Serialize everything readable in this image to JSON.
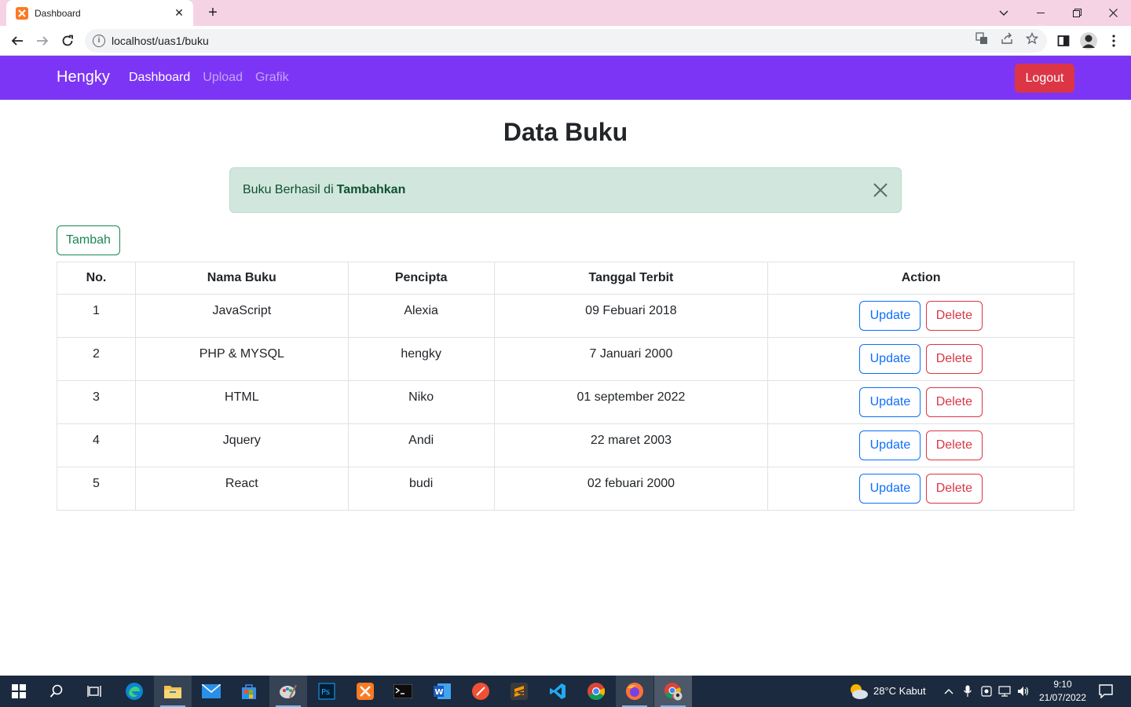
{
  "browser": {
    "tab_title": "Dashboard",
    "url": "localhost/uas1/buku"
  },
  "navbar": {
    "brand": "Hengky",
    "links": [
      {
        "label": "Dashboard",
        "active": true
      },
      {
        "label": "Upload",
        "active": false
      },
      {
        "label": "Grafik",
        "active": false
      }
    ],
    "logout_label": "Logout",
    "background": "#7c35f5"
  },
  "main": {
    "title": "Data Buku",
    "alert": {
      "text": "Buku Berhasil di",
      "bold": "Tambahkan"
    },
    "add_button": "Tambah",
    "table": {
      "headers": [
        "No.",
        "Nama Buku",
        "Pencipta",
        "Tanggal Terbit",
        "Action"
      ],
      "rows": [
        {
          "no": "1",
          "nama": "JavaScript",
          "pencipta": "Alexia",
          "tanggal": "09 Febuari 2018"
        },
        {
          "no": "2",
          "nama": "PHP & MYSQL",
          "pencipta": "hengky",
          "tanggal": "7 Januari 2000"
        },
        {
          "no": "3",
          "nama": "HTML",
          "pencipta": "Niko",
          "tanggal": "01 september 2022"
        },
        {
          "no": "4",
          "nama": "Jquery",
          "pencipta": "Andi",
          "tanggal": "22 maret 2003"
        },
        {
          "no": "5",
          "nama": "React",
          "pencipta": "budi",
          "tanggal": "02 febuari 2000"
        }
      ],
      "update_label": "Update",
      "delete_label": "Delete"
    }
  },
  "taskbar": {
    "weather": "28°C  Kabut",
    "time": "9:10",
    "date": "21/07/2022"
  }
}
